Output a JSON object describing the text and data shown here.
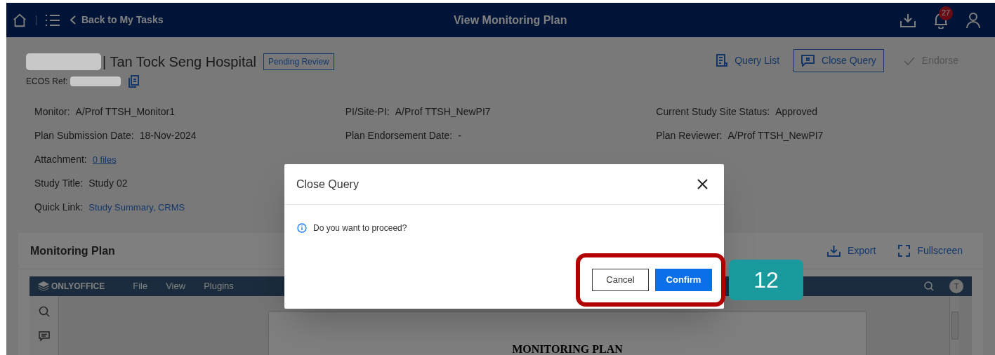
{
  "top_bar": {
    "back_link": "Back to My Tasks",
    "title": "View Monitoring Plan",
    "notification_count": "27"
  },
  "header": {
    "title": "| Tan Tock Seng Hospital",
    "status_badge": "Pending Review",
    "ref_label": "ECOS Ref:",
    "actions": [
      {
        "label": "Query List",
        "kind": "link",
        "disabled": false
      },
      {
        "label": "Close Query",
        "kind": "outline",
        "disabled": false
      },
      {
        "label": "Endorse",
        "kind": "solid",
        "disabled": true
      }
    ]
  },
  "details": [
    [
      {
        "label": "Monitor:",
        "value": "A/Prof TTSH_Monitor1",
        "kind": "text"
      },
      {
        "label": "Plan Submission Date:",
        "value": "18-Nov-2024",
        "kind": "text"
      },
      {
        "label": "Attachment:",
        "value": "0 files",
        "kind": "link"
      },
      {
        "label": "Study Title:",
        "value": "Study 02",
        "kind": "text"
      },
      {
        "label": "Quick Link:",
        "value": "Study Summary, CRMS",
        "kind": "link"
      }
    ],
    [
      {
        "label": "PI/Site-PI:",
        "value": "A/Prof TTSH_NewPI7",
        "kind": "text"
      },
      {
        "label": "Plan Endorsement Date:",
        "value": "-",
        "kind": "text"
      }
    ],
    [
      {
        "label": "Current Study Site Status:",
        "value": "Approved",
        "kind": "text"
      },
      {
        "label": "Plan Reviewer:",
        "value": "A/Prof TTSH_NewPI7",
        "kind": "text"
      }
    ]
  ],
  "plan_panel": {
    "title": "Monitoring Plan",
    "actions": [
      "Export",
      "Fullscreen"
    ],
    "editor": {
      "brand": "ONLYOFFICE",
      "menu": [
        "File",
        "View",
        "Plugins"
      ],
      "avatar": "T",
      "document_heading": "MONITORING PLAN"
    }
  },
  "dialog": {
    "title": "Close Query",
    "message": "Do you want to proceed?",
    "buttons": [
      {
        "label": "Cancel",
        "kind": "secondary"
      },
      {
        "label": "Confirm",
        "kind": "primary"
      }
    ]
  },
  "step_badge": "12"
}
